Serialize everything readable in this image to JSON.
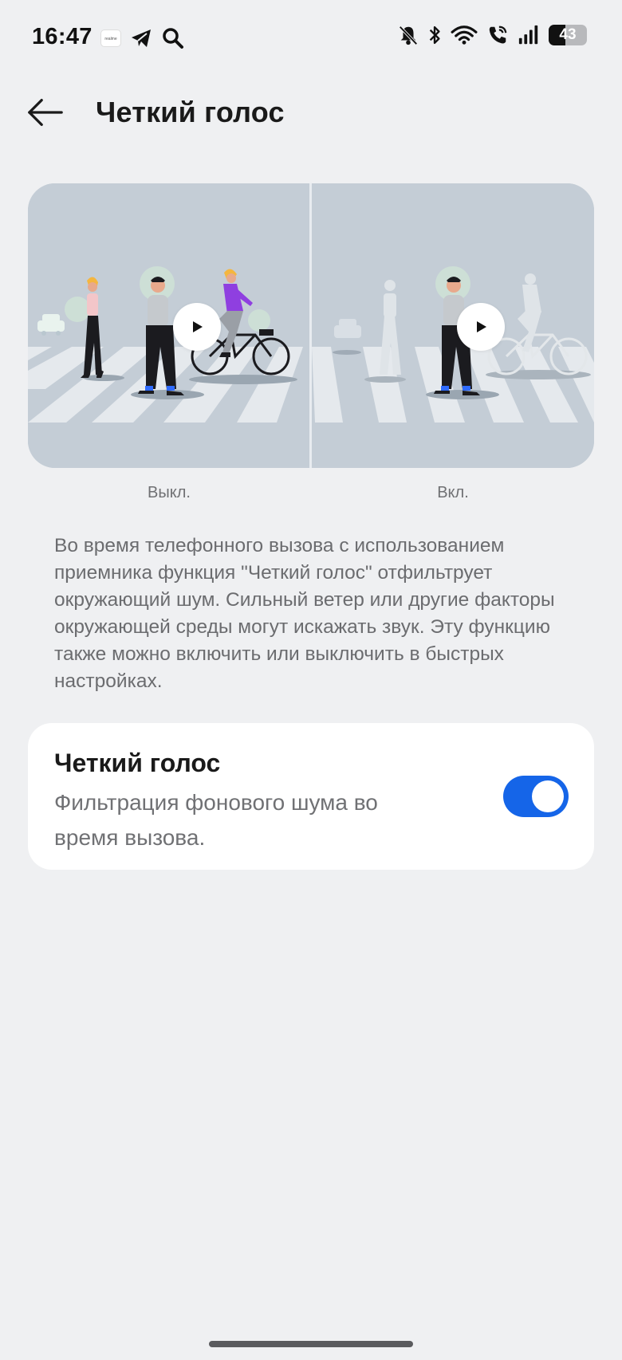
{
  "status_bar": {
    "time": "16:47",
    "left_icons": [
      "app-notification-icon",
      "telegram-icon",
      "search-icon"
    ],
    "right_icons": [
      "bell-muted-icon",
      "bluetooth-icon",
      "wifi-icon",
      "wifi-call-icon",
      "signal-icon"
    ],
    "battery_level": "43",
    "battery_fraction": 0.43
  },
  "header": {
    "back_icon": "arrow-left-icon",
    "title": "Четкий голос"
  },
  "illustration": {
    "left_label": "Выкл.",
    "right_label": "Вкл.",
    "play_icon": "play-icon"
  },
  "description": "Во время телефонного вызова с использованием приемника функция \"Четкий голос\" отфильтрует окружающий шум. Сильный ветер или другие факторы окружающей среды могут искажать звук. Эту функцию также можно включить или выключить в быстрых настройках.",
  "setting": {
    "title": "Четкий голос",
    "subtitle": "Фильтрация фонового шума во время вызова.",
    "enabled": true
  },
  "colors": {
    "background": "#eff0f2",
    "accent": "#1565e8",
    "card": "#ffffff"
  }
}
